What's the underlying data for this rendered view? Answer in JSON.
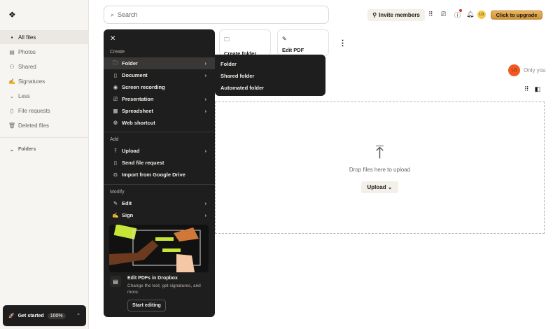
{
  "sidebar": {
    "items": [
      {
        "label": "All files",
        "icon": "files-icon"
      },
      {
        "label": "Photos",
        "icon": "photo-icon"
      },
      {
        "label": "Shared",
        "icon": "shared-icon"
      },
      {
        "label": "Signatures",
        "icon": "signature-icon"
      },
      {
        "label": "Less",
        "icon": "chevron-down-icon"
      },
      {
        "label": "File requests",
        "icon": "file-request-icon"
      },
      {
        "label": "Deleted files",
        "icon": "trash-icon"
      }
    ],
    "folders": "Folders",
    "get_started": "Get started",
    "progress": "100%"
  },
  "header": {
    "search_placeholder": "Search",
    "invite": "Invite members",
    "avatar": "LO",
    "upgrade": "Click to upgrade"
  },
  "cards": [
    {
      "label": "Create folder"
    },
    {
      "label": "Edit PDF"
    }
  ],
  "owner": {
    "avatar": "LO",
    "label": "Only you"
  },
  "drop": {
    "text": "Drop files here to upload",
    "button": "Upload"
  },
  "menu": {
    "create": "Create",
    "add": "Add",
    "modify": "Modify",
    "create_items": [
      "Folder",
      "Document",
      "Screen recording",
      "Presentation",
      "Spreadsheet",
      "Web shortcut"
    ],
    "add_items": [
      "Upload",
      "Send file request",
      "Import from Google Drive"
    ],
    "modify_items": [
      "Edit",
      "Sign"
    ],
    "promo": {
      "title": "Edit PDFs in Dropbox",
      "desc": "Change the text, get signatures, and more.",
      "button": "Start editing"
    }
  },
  "submenu": [
    "Folder",
    "Shared folder",
    "Automated folder"
  ],
  "colors": {
    "accent": "#f05a22",
    "menu_bg": "#1e1e1e",
    "upgrade": "#e0a548"
  }
}
